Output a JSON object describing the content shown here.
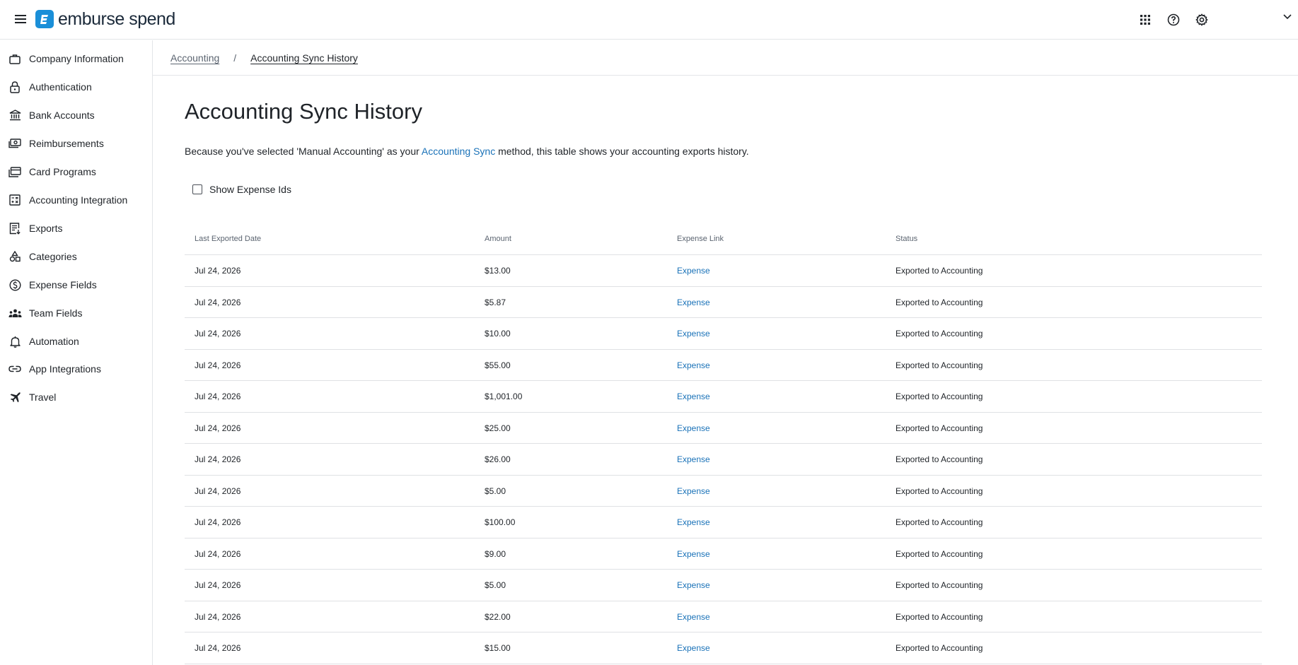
{
  "header": {
    "brand": "emburse spend",
    "icons": [
      "apps-grid-icon",
      "help-icon",
      "settings-gear-icon",
      "chevron-down-icon"
    ]
  },
  "sidebar": {
    "items": [
      {
        "label": "Company Information",
        "icon": "briefcase-icon"
      },
      {
        "label": "Authentication",
        "icon": "lock-icon"
      },
      {
        "label": "Bank Accounts",
        "icon": "bank-icon"
      },
      {
        "label": "Reimbursements",
        "icon": "cash-icon"
      },
      {
        "label": "Card Programs",
        "icon": "cards-icon"
      },
      {
        "label": "Accounting Integration",
        "icon": "calculator-icon"
      },
      {
        "label": "Exports",
        "icon": "export-document-icon"
      },
      {
        "label": "Categories",
        "icon": "shapes-icon"
      },
      {
        "label": "Expense Fields",
        "icon": "dollar-circle-icon"
      },
      {
        "label": "Team Fields",
        "icon": "team-icon"
      },
      {
        "label": "Automation",
        "icon": "bell-icon"
      },
      {
        "label": "App Integrations",
        "icon": "link-icon"
      },
      {
        "label": "Travel",
        "icon": "airplane-icon"
      }
    ]
  },
  "breadcrumb": {
    "parent": "Accounting",
    "separator": "/",
    "current": "Accounting Sync History"
  },
  "main": {
    "title": "Accounting Sync History",
    "description_before": "Because you've selected 'Manual Accounting' as your ",
    "description_link": "Accounting Sync",
    "description_after": " method, this table shows your accounting exports history.",
    "show_ids_label": "Show Expense Ids",
    "show_ids_checked": false
  },
  "table": {
    "columns": [
      "Last Exported Date",
      "Amount",
      "Expense Link",
      "Status"
    ],
    "rows": [
      {
        "date": "Jul 24, 2026",
        "amount": "$13.00",
        "link": "Expense",
        "status": "Exported to Accounting"
      },
      {
        "date": "Jul 24, 2026",
        "amount": "$5.87",
        "link": "Expense",
        "status": "Exported to Accounting"
      },
      {
        "date": "Jul 24, 2026",
        "amount": "$10.00",
        "link": "Expense",
        "status": "Exported to Accounting"
      },
      {
        "date": "Jul 24, 2026",
        "amount": "$55.00",
        "link": "Expense",
        "status": "Exported to Accounting"
      },
      {
        "date": "Jul 24, 2026",
        "amount": "$1,001.00",
        "link": "Expense",
        "status": "Exported to Accounting"
      },
      {
        "date": "Jul 24, 2026",
        "amount": "$25.00",
        "link": "Expense",
        "status": "Exported to Accounting"
      },
      {
        "date": "Jul 24, 2026",
        "amount": "$26.00",
        "link": "Expense",
        "status": "Exported to Accounting"
      },
      {
        "date": "Jul 24, 2026",
        "amount": "$5.00",
        "link": "Expense",
        "status": "Exported to Accounting"
      },
      {
        "date": "Jul 24, 2026",
        "amount": "$100.00",
        "link": "Expense",
        "status": "Exported to Accounting"
      },
      {
        "date": "Jul 24, 2026",
        "amount": "$9.00",
        "link": "Expense",
        "status": "Exported to Accounting"
      },
      {
        "date": "Jul 24, 2026",
        "amount": "$5.00",
        "link": "Expense",
        "status": "Exported to Accounting"
      },
      {
        "date": "Jul 24, 2026",
        "amount": "$22.00",
        "link": "Expense",
        "status": "Exported to Accounting"
      },
      {
        "date": "Jul 24, 2026",
        "amount": "$15.00",
        "link": "Expense",
        "status": "Exported to Accounting"
      }
    ]
  }
}
